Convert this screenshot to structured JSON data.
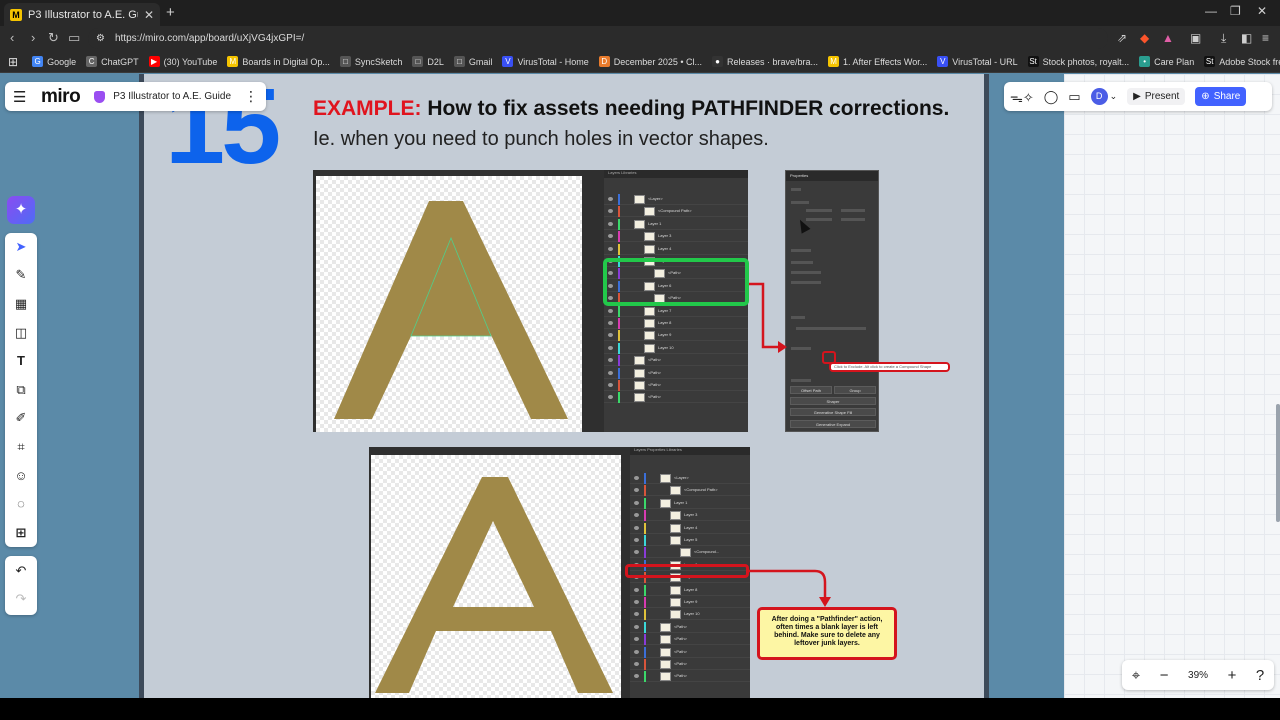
{
  "browser": {
    "tab_title": "P3 Illustrator to A.E. Guide - Miro",
    "tab_favicon": "M",
    "url": "https://miro.com/app/board/uXjVG4jxGPI=/",
    "bookmarks": [
      {
        "label": "Google",
        "icon": "G",
        "color": "#4285f4"
      },
      {
        "label": "ChatGPT",
        "icon": "C",
        "color": "#666666"
      },
      {
        "label": "(30) YouTube",
        "icon": "▶",
        "color": "#ff0000"
      },
      {
        "label": "Boards in Digital Op...",
        "icon": "M",
        "color": "#f5c400"
      },
      {
        "label": "SyncSketch",
        "icon": "□",
        "color": "#555555"
      },
      {
        "label": "D2L",
        "icon": "□",
        "color": "#555555"
      },
      {
        "label": "Gmail",
        "icon": "□",
        "color": "#555555"
      },
      {
        "label": "VirusTotal - Home",
        "icon": "V",
        "color": "#3950f5"
      },
      {
        "label": "December 2025 • Cl...",
        "icon": "D",
        "color": "#e97b2c"
      },
      {
        "label": "Releases · brave/bra...",
        "icon": "●",
        "color": "#333333"
      },
      {
        "label": "1. After Effects Wor...",
        "icon": "M",
        "color": "#f5c400"
      },
      {
        "label": "VirusTotal - URL",
        "icon": "V",
        "color": "#3950f5"
      },
      {
        "label": "Stock photos, royalt...",
        "icon": "St",
        "color": "#111111"
      },
      {
        "label": "Care Plan",
        "icon": "•",
        "color": "#2a9d8f"
      },
      {
        "label": "Adobe Stock free tri...",
        "icon": "St",
        "color": "#111111"
      }
    ]
  },
  "miro": {
    "logo": "miro",
    "board_name": "P3 Illustrator to A.E. Guide",
    "avatar_initial": "D",
    "present_label": "Present",
    "share_label": "Share",
    "zoom_level": "39%",
    "accent_color": "#4262ff",
    "tools": [
      "cursor-icon",
      "template-icon",
      "layout-icon",
      "sticky-note-icon",
      "text-icon",
      "shapes-icon",
      "pen-icon",
      "frame-icon",
      "stickers-icon",
      "comment-icon",
      "plus-icon"
    ]
  },
  "board": {
    "step_number": "15",
    "heading_prefix": "EXAMPLE:",
    "heading_text": " How to fix assets needing PATHFINDER corrections.",
    "subheading": "Ie. when you need to punch holes in vector shapes.",
    "tooltip": "Click to Exclude. Alt click to create a Compound Shape",
    "note": "After doing a \"Pathfinder\" action, often times a blank layer is left behind. Make sure to delete any leftover junk layers.",
    "props_panel": {
      "title": "Properties",
      "buttons": [
        "Offset Path",
        "Group",
        "Shaper",
        "Generative Shape Fill",
        "Generative Expand"
      ]
    },
    "layers_tabs": [
      "Layers",
      "Libraries"
    ],
    "layers_tabs_2": [
      "Layers",
      "Properties",
      "Libraries"
    ],
    "layers_top": [
      "<Layer>",
      "<Compound Path>",
      "Layer 1",
      "Layer 3",
      "Layer 4",
      "Layer 5",
      "<Path>",
      "Layer 6",
      "<Path>",
      "Layer 7",
      "Layer 8",
      "Layer 9",
      "Layer 10",
      "<Path>",
      "<Path>",
      "<Path>",
      "<Path>"
    ],
    "layers_bottom": [
      "<Layer>",
      "<Compound Path>",
      "Layer 1",
      "Layer 3",
      "Layer 4",
      "Layer 5",
      "<Compound...",
      "Layer 6",
      "Layer 7",
      "Layer 8",
      "Layer 9",
      "Layer 10",
      "<Path>",
      "<Path>",
      "<Path>",
      "<Path>",
      "<Path>"
    ]
  }
}
